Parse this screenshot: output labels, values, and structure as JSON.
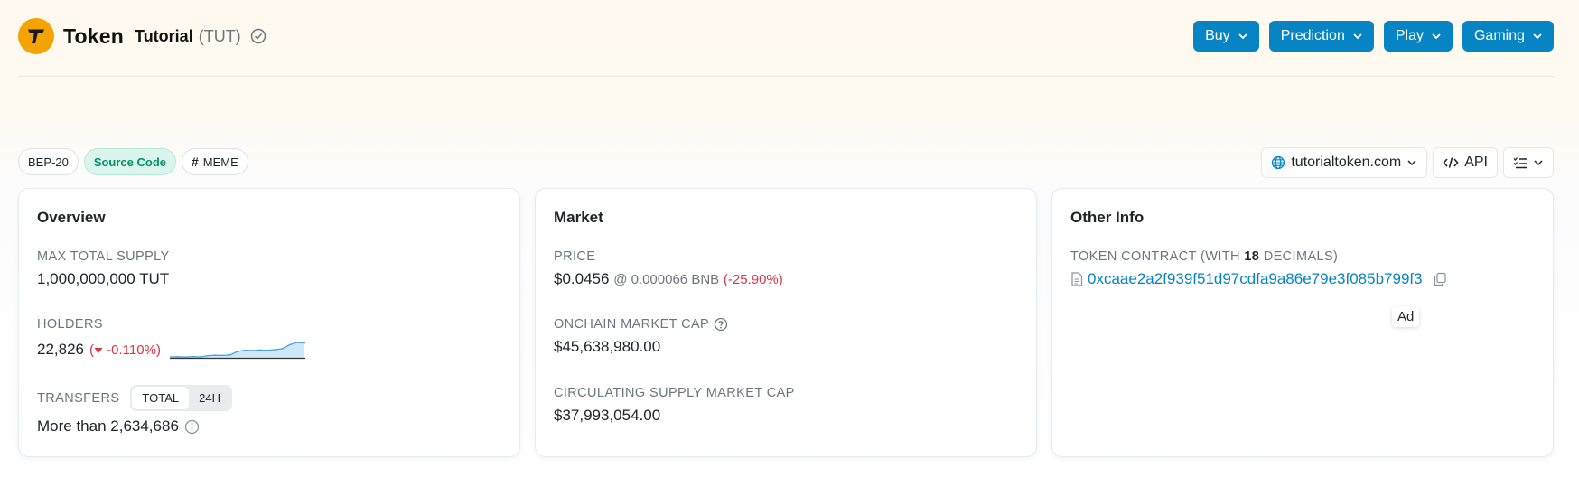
{
  "header": {
    "brand": "Token",
    "token_name": "Tutorial",
    "token_symbol": "(TUT)",
    "nav": [
      {
        "label": "Buy"
      },
      {
        "label": "Prediction"
      },
      {
        "label": "Play"
      },
      {
        "label": "Gaming"
      }
    ]
  },
  "tags": {
    "standard": "BEP-20",
    "source": "Source Code",
    "meme": "MEME"
  },
  "actions": {
    "website": "tutorialtoken.com",
    "api": "API"
  },
  "overview": {
    "title": "Overview",
    "max_supply_label": "MAX TOTAL SUPPLY",
    "max_supply_value": "1,000,000,000 TUT",
    "holders_label": "HOLDERS",
    "holders_value": "22,826",
    "holders_change": "-0.110%",
    "holders_trend": [
      0.05,
      0.06,
      0.04,
      0.07,
      0.05,
      0.12,
      0.14,
      0.13,
      0.16,
      0.35,
      0.42,
      0.4,
      0.43,
      0.41,
      0.45,
      0.5,
      0.72,
      0.85,
      0.82
    ],
    "transfers_label": "TRANSFERS",
    "transfers_tab_total": "TOTAL",
    "transfers_tab_24h": "24H",
    "transfers_value": "More than 2,634,686"
  },
  "market": {
    "title": "Market",
    "price_label": "PRICE",
    "price_value": "$0.0456",
    "price_bnb": "@ 0.000066 BNB",
    "price_change": "(-25.90%)",
    "onchain_label": "ONCHAIN MARKET CAP",
    "onchain_value": "$45,638,980.00",
    "circ_label": "CIRCULATING SUPPLY MARKET CAP",
    "circ_value": "$37,993,054.00"
  },
  "other": {
    "title": "Other Info",
    "contract_label_pre": "TOKEN CONTRACT (WITH",
    "decimals": "18",
    "contract_label_post": "DECIMALS)",
    "contract_address": "0xcaae2a2f939f51d97cdfa9a86e79e3f085b799f3",
    "ad_label": "Ad"
  },
  "colors": {
    "accent": "#0784c3",
    "logo": "#f5a300",
    "negative": "#dc3545",
    "source_green": "#00936a"
  }
}
